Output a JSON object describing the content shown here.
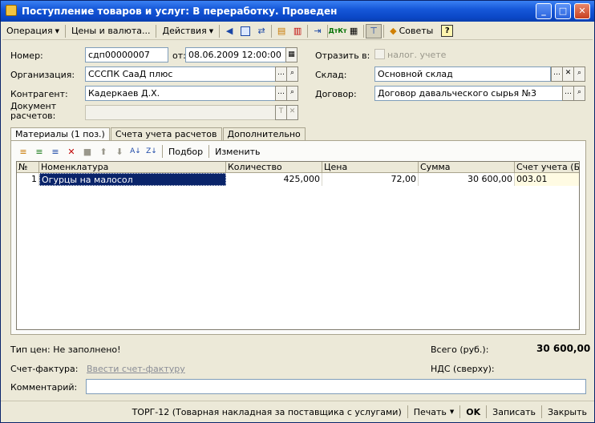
{
  "window": {
    "title": "Поступление товаров и услуг: В переработку. Проведен",
    "buttons": {
      "minimize": "_",
      "maximize": "□",
      "close": "✕"
    }
  },
  "toolbar": {
    "operation": "Операция",
    "prices": "Цены и валюта...",
    "actions": "Действия",
    "dtkt": "ДтКт",
    "tips": "Советы",
    "help": "?"
  },
  "form": {
    "number_label": "Номер:",
    "number_value": "сдп00000007",
    "date_label": "от:",
    "date_value": "08.06.2009 12:00:00",
    "reflect_label": "Отразить в:",
    "tax_label": "налог. учете",
    "org_label": "Организация:",
    "org_value": "СССПК СааД плюс",
    "warehouse_label": "Склад:",
    "warehouse_value": "Основной склад",
    "counterparty_label": "Контрагент:",
    "counterparty_value": "Кадеркаев Д.Х.",
    "contract_label": "Договор:",
    "contract_value": "Договор давальческого сырья №3",
    "doc_label_1": "Документ",
    "doc_label_2": "расчетов:",
    "doc_value": ""
  },
  "tabs": [
    {
      "label": "Материалы (1 поз.)",
      "active": true
    },
    {
      "label": "Счета учета расчетов",
      "active": false
    },
    {
      "label": "Дополнительно",
      "active": false
    }
  ],
  "panel_toolbar": {
    "select": "Подбор",
    "edit": "Изменить"
  },
  "table": {
    "headers": [
      "№",
      "Номенклатура",
      "Количество",
      "Цена",
      "Сумма",
      "Счет учета (БУ)"
    ],
    "rows": [
      {
        "n": "1",
        "item": "Огурцы на малосол",
        "qty": "425,000",
        "price": "72,00",
        "sum": "30 600,00",
        "account": "003.01"
      }
    ]
  },
  "bottom": {
    "price_type": "Тип цен: Не заполнено!",
    "total_label": "Всего (руб.):",
    "total_value": "30 600,00",
    "invoice_label": "Счет-фактура:",
    "invoice_link": "Ввести счет-фактуру",
    "vat_label": "НДС (сверху):",
    "comment_label": "Комментарий:",
    "comment_value": ""
  },
  "footer": {
    "torg": "ТОРГ-12 (Товарная накладная за поставщика с услугами)",
    "print": "Печать",
    "ok": "OK",
    "save": "Записать",
    "close": "Закрыть"
  },
  "colors": {
    "accent": "#0a246a",
    "titlebar": "#0b47c7",
    "window": "#ece9d8"
  }
}
